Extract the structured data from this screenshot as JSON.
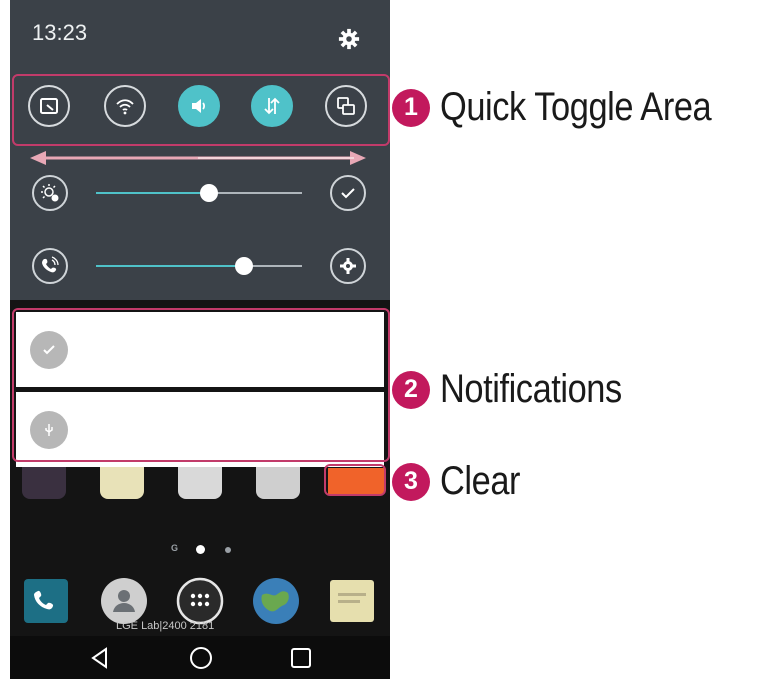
{
  "status_bar": {
    "time": "13:23",
    "settings_icon": "gear-icon"
  },
  "quick_toggles": [
    {
      "icon": "screen-capture-icon",
      "on": false
    },
    {
      "icon": "wifi-icon",
      "on": false
    },
    {
      "icon": "sound-icon",
      "on": true
    },
    {
      "icon": "data-transfer-icon",
      "on": true
    },
    {
      "icon": "screen-rotation-icon",
      "on": false
    }
  ],
  "brightness": {
    "level_percent": 55,
    "icon": "brightness-auto-icon",
    "end_icon": "check-circle-icon"
  },
  "call_volume": {
    "level_percent": 72,
    "icon": "call-volume-icon",
    "end_icon": "gear-icon"
  },
  "notifications": [
    {
      "icon": "check-icon"
    },
    {
      "icon": "usb-icon"
    }
  ],
  "home": {
    "watermark": "LGE Lab|2400 2181",
    "dock_icons": [
      "phone-icon",
      "contacts-icon",
      "apps-icon",
      "browser-icon",
      "messages-icon"
    ],
    "nav_buttons": [
      "back-icon",
      "home-icon",
      "recents-icon"
    ],
    "page_indicator": "G"
  },
  "callouts": [
    {
      "number": "1",
      "text": "Quick Toggle Area"
    },
    {
      "number": "2",
      "text": "Notifications"
    },
    {
      "number": "3",
      "text": "Clear"
    }
  ],
  "colors": {
    "accent": "#4fc2c9",
    "callout": "#c2195d",
    "shade": "#3b4148",
    "clear_button": "#f0632a"
  }
}
